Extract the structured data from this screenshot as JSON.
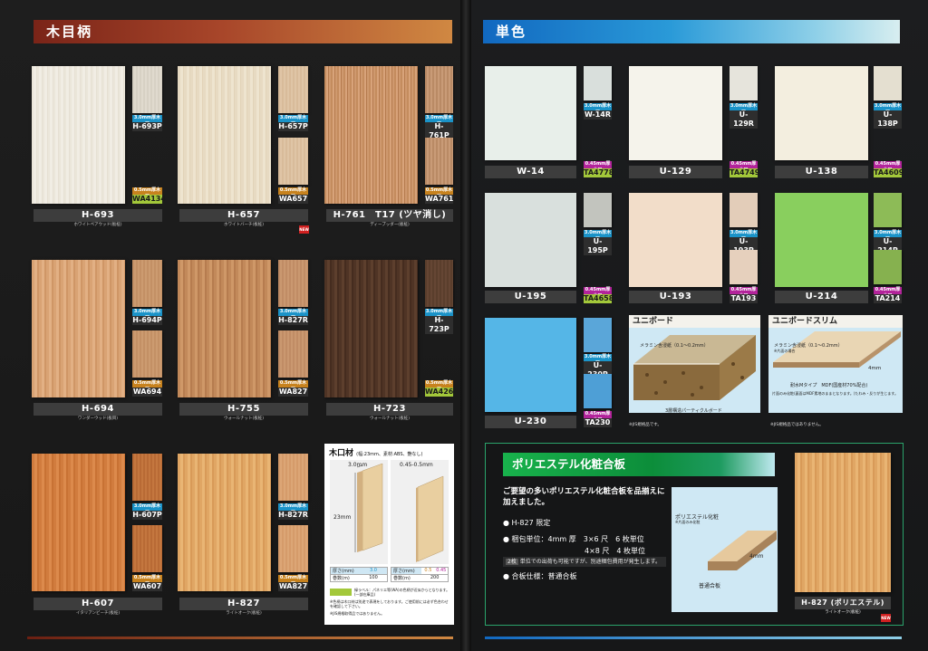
{
  "left_page": {
    "section_title": "木目柄",
    "rows": [
      [
        {
          "code": "H-693",
          "name": "ホワイトペアウッド(板柾)",
          "small": [
            {
              "code": "H-693P",
              "thickness": "3.0mm厚木口",
              "kind": "3"
            },
            {
              "code": "WA4134",
              "thickness": "0.5mm厚木口",
              "kind": "05",
              "green": true
            }
          ],
          "new": false
        },
        {
          "code": "H-657",
          "name": "ホワイトバーチ(板柾)",
          "small": [
            {
              "code": "H-657P",
              "thickness": "3.0mm厚木口",
              "kind": "3"
            },
            {
              "code": "WA657",
              "thickness": "0.5mm厚木口",
              "kind": "05"
            }
          ],
          "new": true
        },
        {
          "code": "H-761　T17 (ツヤ消し)",
          "name": "ディープッダー(板柾)",
          "small": [
            {
              "code": "H-761P",
              "thickness": "3.0mm厚木口",
              "kind": "3"
            },
            {
              "code": "WA761",
              "thickness": "0.5mm厚木口",
              "kind": "05"
            }
          ],
          "new": false
        }
      ],
      [
        {
          "code": "H-694",
          "name": "ワンダーウッド(板目)",
          "small": [
            {
              "code": "H-694P",
              "thickness": "3.0mm厚木口",
              "kind": "3"
            },
            {
              "code": "WA694",
              "thickness": "0.5mm厚木口",
              "kind": "05"
            }
          ],
          "new": false
        },
        {
          "code": "H-755",
          "name": "ウォールナット(板柾)",
          "small": [
            {
              "code": "H-827R",
              "thickness": "3.0mm厚木口",
              "kind": "3"
            },
            {
              "code": "WA827",
              "thickness": "0.5mm厚木口",
              "kind": "05"
            }
          ],
          "new": false
        },
        {
          "code": "H-723",
          "name": "ウォールナット(板柾)",
          "small": [
            {
              "code": "H-723P",
              "thickness": "3.0mm厚木口",
              "kind": "3"
            },
            {
              "code": "WA4268",
              "thickness": "0.5mm厚木口",
              "kind": "05",
              "green": true
            }
          ],
          "new": false
        }
      ],
      [
        {
          "code": "H-607",
          "name": "イタリアンビーチ(板柾)",
          "small": [
            {
              "code": "H-607P",
              "thickness": "3.0mm厚木口",
              "kind": "3"
            },
            {
              "code": "WA607",
              "thickness": "0.5mm厚木口",
              "kind": "05"
            }
          ],
          "new": false
        },
        {
          "code": "H-827",
          "name": "ライトオーク(板柾)",
          "small": [
            {
              "code": "H-827R",
              "thickness": "3.0mm厚木口",
              "kind": "3"
            },
            {
              "code": "WA827",
              "thickness": "0.5mm厚木口",
              "kind": "05"
            }
          ],
          "new": false
        }
      ]
    ],
    "edge_panel": {
      "title": "木口材",
      "spec": "(幅:23mm、素材:ABS、艶なし)",
      "left": {
        "top": "3.0mm",
        "height": "23mm",
        "thick_label": "厚さ(mm)",
        "thick": "3.0",
        "roll_label": "巻数(m)",
        "roll": "100"
      },
      "right": {
        "top": "0.45-0.5mm",
        "thick_label": "厚さ(mm)",
        "thick_a": "0.5",
        "thick_b": "0.45",
        "roll_label": "巻数(m)",
        "roll": "200"
      },
      "legend": "緑ラベル：パネリエ等(WA)の色柄が近似からとなります。(一部在庫品)",
      "notes": "※色柄は木口材は別途で表現をしております。ご使用前には必ず色合わせを確認して下さい。",
      "notes2": "※JIS規格取得品ではありません。"
    }
  },
  "right_page": {
    "section_title": "単色",
    "rows": [
      [
        {
          "code": "W-14",
          "color": "#e8efea",
          "small": [
            {
              "code": "W-14R",
              "thickness": "3.0mm厚木口",
              "kind": "3",
              "color": "#d9dfdc"
            },
            {
              "code": "TA4778",
              "thickness": "0.45mm厚木口",
              "kind": "45",
              "green": true,
              "color": null
            }
          ]
        },
        {
          "code": "U-129",
          "color": "#f5f3eb",
          "small": [
            {
              "code": "U-129R",
              "thickness": "3.0mm厚木口",
              "kind": "3",
              "color": "#e6e4dc"
            },
            {
              "code": "TA4749",
              "thickness": "0.45mm厚木口",
              "kind": "45",
              "green": true,
              "color": null
            }
          ]
        },
        {
          "code": "U-138",
          "color": "#f3eedf",
          "small": [
            {
              "code": "U-138P",
              "thickness": "3.0mm厚木口",
              "kind": "3",
              "color": "#e4dfd0"
            },
            {
              "code": "TA4609",
              "thickness": "0.45mm厚木口",
              "kind": "45",
              "green": true,
              "color": null
            }
          ]
        }
      ],
      [
        {
          "code": "U-195",
          "color": "#d9e0dd",
          "small": [
            {
              "code": "U-195P",
              "thickness": "3.0mm厚木口",
              "kind": "3",
              "color": "#c2c4be"
            },
            {
              "code": "TA4658",
              "thickness": "0.45mm厚木口",
              "kind": "45",
              "green": true,
              "color": null
            }
          ]
        },
        {
          "code": "U-193",
          "color": "#f2ddc9",
          "small": [
            {
              "code": "U-193P",
              "thickness": "3.0mm厚木口",
              "kind": "3",
              "color": "#e3cdb9"
            },
            {
              "code": "TA193",
              "thickness": "0.45mm厚木口",
              "kind": "45",
              "green": false,
              "color": "#e6d0bd"
            }
          ]
        },
        {
          "code": "U-214",
          "color": "#89cf5e",
          "small": [
            {
              "code": "U-214P",
              "thickness": "3.0mm厚木口",
              "kind": "3",
              "color": "#8dbb57"
            },
            {
              "code": "TA214",
              "thickness": "0.45mm厚木口",
              "kind": "45",
              "green": false,
              "color": "#86b14f"
            }
          ]
        }
      ],
      [
        {
          "code": "U-230",
          "color": "#55b6e7",
          "small": [
            {
              "code": "U-230P",
              "thickness": "3.0mm厚木口",
              "kind": "3",
              "color": "#5aa6d9"
            },
            {
              "code": "TA230",
              "thickness": "0.45mm厚木口",
              "kind": "45",
              "green": false,
              "color": "#4e9fd6"
            }
          ]
        }
      ]
    ],
    "unibord": {
      "title": "ユニボード",
      "label1": "メラミン含浸紙（0.1～0.2mm）",
      "label2": "3層構造パーティクルボード",
      "label3": "※JIS規格品です。"
    },
    "unibord_slim": {
      "title": "ユニボードスリム",
      "label1": "メラミン含浸紙（0.1～0.2mm）",
      "label1b": "※片面の場合",
      "thickness": "4mm",
      "label2": "耐水Mタイプ　MDF(国産材70%配合)",
      "desc": "片面のみ化粧(裏面はMDF素地のままとなります。)たわみ・反りが生じます。",
      "label3": "※JIS規格品ではありません。"
    },
    "polyester": {
      "title": "ポリエステル化粧合板",
      "intro": "ご要望の多いポリエステル化粧合板を品揃えに加えました。",
      "item1": "● H-827 限定",
      "item2a": "● 梱包単位：4mm 厚　3×6 尺　6 枚単位",
      "item2b": "4×8 尺　4 枚単位",
      "note_tag": "2枚",
      "note": "単位での出荷も可能ですが、別途梱包費用が発生します。",
      "item3": "● 合板仕様：普通合板",
      "diagram_label1": "ポリエステル化粧",
      "diagram_label1b": "※片面のみ化粧",
      "diagram_thick": "4mm",
      "diagram_label2": "普通合板",
      "sample_code": "H-827 (ポリエステル)",
      "sample_name": "ライトオーク(板柾)"
    }
  },
  "new_label": "NEW"
}
